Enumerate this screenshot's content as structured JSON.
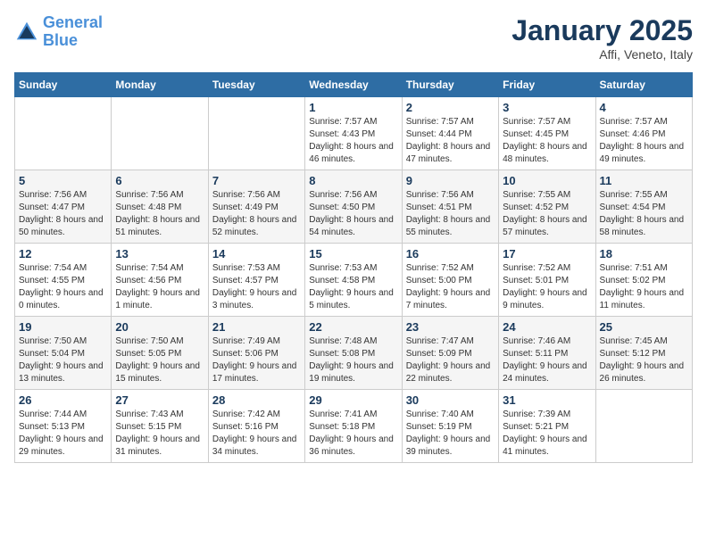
{
  "logo": {
    "line1": "General",
    "line2": "Blue"
  },
  "title": "January 2025",
  "subtitle": "Affi, Veneto, Italy",
  "weekdays": [
    "Sunday",
    "Monday",
    "Tuesday",
    "Wednesday",
    "Thursday",
    "Friday",
    "Saturday"
  ],
  "weeks": [
    [
      {
        "day": "",
        "info": ""
      },
      {
        "day": "",
        "info": ""
      },
      {
        "day": "",
        "info": ""
      },
      {
        "day": "1",
        "info": "Sunrise: 7:57 AM\nSunset: 4:43 PM\nDaylight: 8 hours and 46 minutes."
      },
      {
        "day": "2",
        "info": "Sunrise: 7:57 AM\nSunset: 4:44 PM\nDaylight: 8 hours and 47 minutes."
      },
      {
        "day": "3",
        "info": "Sunrise: 7:57 AM\nSunset: 4:45 PM\nDaylight: 8 hours and 48 minutes."
      },
      {
        "day": "4",
        "info": "Sunrise: 7:57 AM\nSunset: 4:46 PM\nDaylight: 8 hours and 49 minutes."
      }
    ],
    [
      {
        "day": "5",
        "info": "Sunrise: 7:56 AM\nSunset: 4:47 PM\nDaylight: 8 hours and 50 minutes."
      },
      {
        "day": "6",
        "info": "Sunrise: 7:56 AM\nSunset: 4:48 PM\nDaylight: 8 hours and 51 minutes."
      },
      {
        "day": "7",
        "info": "Sunrise: 7:56 AM\nSunset: 4:49 PM\nDaylight: 8 hours and 52 minutes."
      },
      {
        "day": "8",
        "info": "Sunrise: 7:56 AM\nSunset: 4:50 PM\nDaylight: 8 hours and 54 minutes."
      },
      {
        "day": "9",
        "info": "Sunrise: 7:56 AM\nSunset: 4:51 PM\nDaylight: 8 hours and 55 minutes."
      },
      {
        "day": "10",
        "info": "Sunrise: 7:55 AM\nSunset: 4:52 PM\nDaylight: 8 hours and 57 minutes."
      },
      {
        "day": "11",
        "info": "Sunrise: 7:55 AM\nSunset: 4:54 PM\nDaylight: 8 hours and 58 minutes."
      }
    ],
    [
      {
        "day": "12",
        "info": "Sunrise: 7:54 AM\nSunset: 4:55 PM\nDaylight: 9 hours and 0 minutes."
      },
      {
        "day": "13",
        "info": "Sunrise: 7:54 AM\nSunset: 4:56 PM\nDaylight: 9 hours and 1 minute."
      },
      {
        "day": "14",
        "info": "Sunrise: 7:53 AM\nSunset: 4:57 PM\nDaylight: 9 hours and 3 minutes."
      },
      {
        "day": "15",
        "info": "Sunrise: 7:53 AM\nSunset: 4:58 PM\nDaylight: 9 hours and 5 minutes."
      },
      {
        "day": "16",
        "info": "Sunrise: 7:52 AM\nSunset: 5:00 PM\nDaylight: 9 hours and 7 minutes."
      },
      {
        "day": "17",
        "info": "Sunrise: 7:52 AM\nSunset: 5:01 PM\nDaylight: 9 hours and 9 minutes."
      },
      {
        "day": "18",
        "info": "Sunrise: 7:51 AM\nSunset: 5:02 PM\nDaylight: 9 hours and 11 minutes."
      }
    ],
    [
      {
        "day": "19",
        "info": "Sunrise: 7:50 AM\nSunset: 5:04 PM\nDaylight: 9 hours and 13 minutes."
      },
      {
        "day": "20",
        "info": "Sunrise: 7:50 AM\nSunset: 5:05 PM\nDaylight: 9 hours and 15 minutes."
      },
      {
        "day": "21",
        "info": "Sunrise: 7:49 AM\nSunset: 5:06 PM\nDaylight: 9 hours and 17 minutes."
      },
      {
        "day": "22",
        "info": "Sunrise: 7:48 AM\nSunset: 5:08 PM\nDaylight: 9 hours and 19 minutes."
      },
      {
        "day": "23",
        "info": "Sunrise: 7:47 AM\nSunset: 5:09 PM\nDaylight: 9 hours and 22 minutes."
      },
      {
        "day": "24",
        "info": "Sunrise: 7:46 AM\nSunset: 5:11 PM\nDaylight: 9 hours and 24 minutes."
      },
      {
        "day": "25",
        "info": "Sunrise: 7:45 AM\nSunset: 5:12 PM\nDaylight: 9 hours and 26 minutes."
      }
    ],
    [
      {
        "day": "26",
        "info": "Sunrise: 7:44 AM\nSunset: 5:13 PM\nDaylight: 9 hours and 29 minutes."
      },
      {
        "day": "27",
        "info": "Sunrise: 7:43 AM\nSunset: 5:15 PM\nDaylight: 9 hours and 31 minutes."
      },
      {
        "day": "28",
        "info": "Sunrise: 7:42 AM\nSunset: 5:16 PM\nDaylight: 9 hours and 34 minutes."
      },
      {
        "day": "29",
        "info": "Sunrise: 7:41 AM\nSunset: 5:18 PM\nDaylight: 9 hours and 36 minutes."
      },
      {
        "day": "30",
        "info": "Sunrise: 7:40 AM\nSunset: 5:19 PM\nDaylight: 9 hours and 39 minutes."
      },
      {
        "day": "31",
        "info": "Sunrise: 7:39 AM\nSunset: 5:21 PM\nDaylight: 9 hours and 41 minutes."
      },
      {
        "day": "",
        "info": ""
      }
    ]
  ]
}
